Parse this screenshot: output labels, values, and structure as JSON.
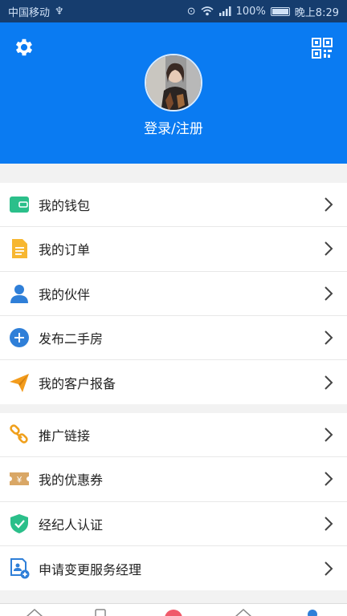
{
  "status_bar": {
    "carrier": "中国移动",
    "battery": "100%",
    "time": "晚上8:29"
  },
  "header": {
    "login_label": "登录/注册"
  },
  "menu_group_1": [
    {
      "label": "我的钱包",
      "icon": "wallet-icon",
      "color": "#2bbf8a"
    },
    {
      "label": "我的订单",
      "icon": "order-document-icon",
      "color": "#f7b731"
    },
    {
      "label": "我的伙伴",
      "icon": "person-icon",
      "color": "#2f7fd8"
    },
    {
      "label": "发布二手房",
      "icon": "plus-circle-icon",
      "color": "#2f7fd8"
    },
    {
      "label": "我的客户报备",
      "icon": "paper-plane-icon",
      "color": "#f39c1c"
    }
  ],
  "menu_group_2": [
    {
      "label": "推广链接",
      "icon": "link-icon",
      "color": "#f0a01c"
    },
    {
      "label": "我的优惠券",
      "icon": "coupon-icon",
      "color": "#d9a766",
      "symbol": "¥"
    },
    {
      "label": "经纪人认证",
      "icon": "shield-check-icon",
      "color": "#2bbf8a"
    },
    {
      "label": "申请变更服务经理",
      "icon": "id-card-icon",
      "color": "#2f7fd8"
    }
  ],
  "colors": {
    "header_bg": "#0a7bf2",
    "status_bg": "#163d6e",
    "page_bg": "#f2f2f2"
  }
}
